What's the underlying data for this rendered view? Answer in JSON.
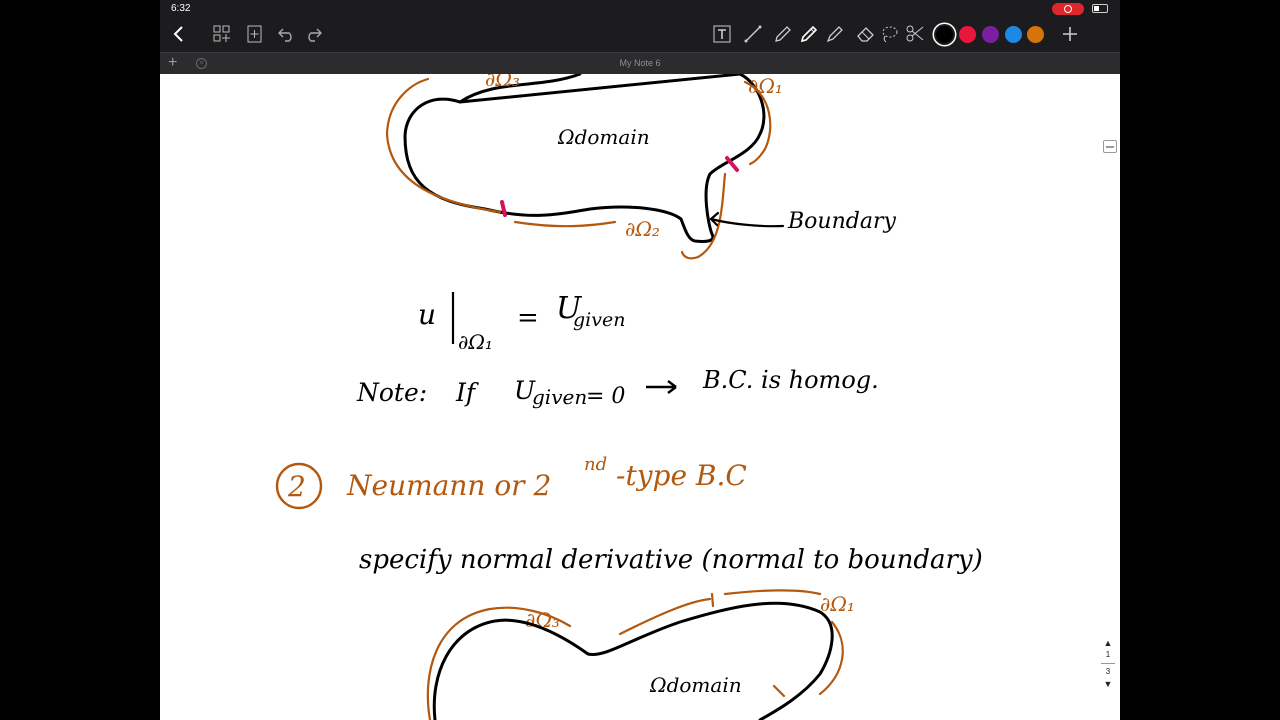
{
  "status": {
    "time": "6:32"
  },
  "note": {
    "title": "My Note 6"
  },
  "palette": {
    "colors": [
      "#000000",
      "#e8173c",
      "#7b1fa2",
      "#1e88e5",
      "#d4740b"
    ],
    "ink": "#000000",
    "accent_ink": "#b3590f",
    "marker": "#d4145a"
  },
  "toolbar": {
    "back_icon": "chevron-left-icon",
    "tools": [
      "grid-add-icon",
      "page-add-icon",
      "undo-icon",
      "redo-icon",
      "text-tool-icon",
      "line-tool-icon",
      "pencil-icon",
      "pen-icon",
      "highlighter-icon",
      "eraser-icon",
      "lasso-icon",
      "scissors-icon"
    ],
    "add_icon": "plus-icon"
  },
  "handwriting": {
    "boundary_top_right": "∂Ω₁",
    "boundary_top_left": "∂Ω₃",
    "boundary_bottom": "∂Ω₂",
    "domain_label": "Ωdomain",
    "boundary_label": "Boundary",
    "equation_lhs": "u",
    "equation_sub": "∂Ω₁",
    "equation_rhs": "U",
    "equation_rhs_sub": "given",
    "note_label": "Note:",
    "note_if": "If",
    "note_u": "U",
    "note_u_sub": "given",
    "note_eq": "= 0",
    "note_result": "B.C. is homog.",
    "section_number": "2",
    "section_title_a": "Neumann or 2",
    "section_title_sup": "nd",
    "section_title_b": "-type B.C",
    "spec_line": "specify   normal   derivative   (normal  to  boundary)",
    "bottom_top_left": "∂Ω₃",
    "bottom_top_right": "∂Ω₁",
    "bottom_domain_label": "Ωdomain"
  },
  "pager": {
    "current": "1",
    "total": "3"
  }
}
